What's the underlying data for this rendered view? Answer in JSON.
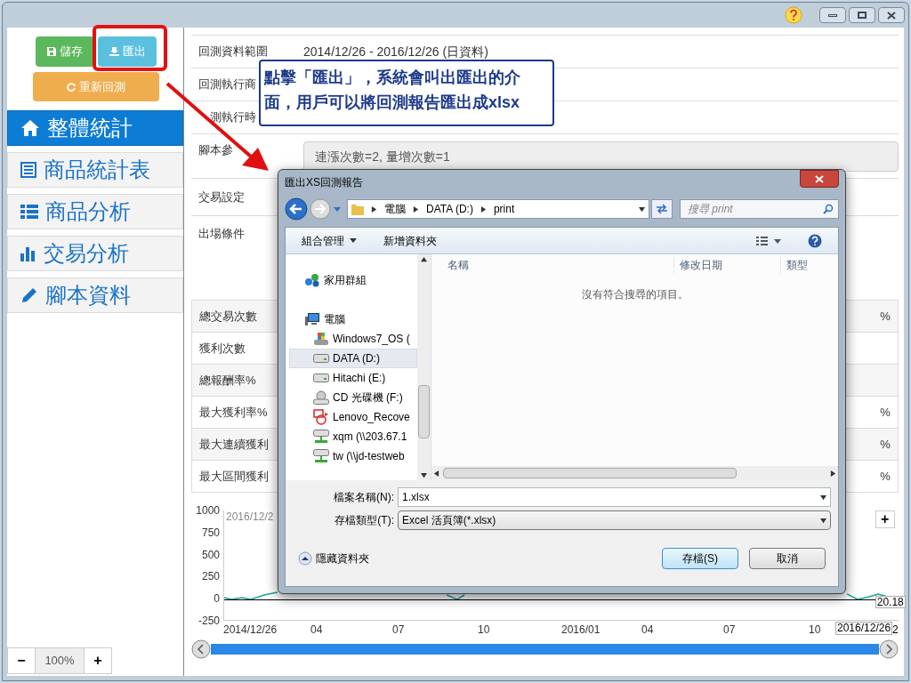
{
  "toolbar": {
    "save": "儲存",
    "export": "匯出",
    "rerun": "重新回測"
  },
  "nav": [
    {
      "label": "整體統計",
      "kind": "home",
      "selected": true
    },
    {
      "label": "商品統計表",
      "kind": "table",
      "selected": false
    },
    {
      "label": "商品分析",
      "kind": "list",
      "selected": false
    },
    {
      "label": "交易分析",
      "kind": "bars",
      "selected": false
    },
    {
      "label": "腳本資料",
      "kind": "pencil",
      "selected": false
    }
  ],
  "zoom": {
    "minus": "−",
    "value": "100%",
    "plus": "+"
  },
  "info_rows": [
    {
      "label": "回測資料範圍",
      "value": "2014/12/26 - 2016/12/26 (日資料)"
    },
    {
      "label": "回測執行商"
    },
    {
      "label": "測執行時"
    },
    {
      "label": "腳本參",
      "field": "連漲次數=2, 量增次數=1"
    },
    {
      "label": "交易設定"
    },
    {
      "label": "出場條件"
    }
  ],
  "stats_rows": [
    {
      "label": "總交易次數",
      "value": "%"
    },
    {
      "label": "獲利次數"
    },
    {
      "label": "總報酬率%"
    },
    {
      "label": "最大獲利率%",
      "value": "%"
    },
    {
      "label": "最大連續獲利",
      "value": "%"
    },
    {
      "label": "最大區間獲利",
      "value": "%"
    }
  ],
  "chart": {
    "y_labels": [
      "1000",
      "750",
      "500",
      "250",
      "0",
      "-250"
    ],
    "x_labels": [
      "2014/12/26",
      "04",
      "07",
      "10",
      "2016/01",
      "04",
      "07",
      "10"
    ],
    "start_flag": "2016/12/2",
    "end_flag": "2016/12/26",
    "last_value": "20.18",
    "cut_label": "2",
    "zoom_button": "+"
  },
  "callout": "點擊「匯出」，系統會叫出匯出的介面，用戶可以將回測報告匯出成xlsx",
  "dialog": {
    "title": "匯出XS回測報告",
    "path": [
      "電腦",
      "DATA (D:)",
      "print"
    ],
    "search": {
      "placeholder": "搜尋 print"
    },
    "organize": "組合管理",
    "new_folder": "新增資料夾",
    "tree": [
      {
        "label": "家用群組",
        "kind": "group",
        "selected": false
      },
      {
        "label": "電腦",
        "kind": "computer",
        "selected": false
      },
      {
        "label": "Windows7_OS (",
        "kind": "os",
        "selected": false
      },
      {
        "label": "DATA (D:)",
        "kind": "drive",
        "selected": true
      },
      {
        "label": "Hitachi (E:)",
        "kind": "drive",
        "selected": false
      },
      {
        "label": "CD 光碟機 (F:)",
        "kind": "cd",
        "selected": false
      },
      {
        "label": "Lenovo_Recove",
        "kind": "recovery",
        "selected": false
      },
      {
        "label": "xqm (\\\\203.67.1",
        "kind": "network",
        "selected": false
      },
      {
        "label": "tw (\\\\jd-testweb",
        "kind": "network",
        "selected": false
      }
    ],
    "columns": [
      "名稱",
      "修改日期",
      "類型"
    ],
    "empty_message": "沒有符合搜尋的項目。",
    "filename_label": "檔案名稱(N):",
    "filename": "1.xlsx",
    "filetype_label": "存檔類型(T):",
    "filetype": "Excel 活頁簿(*.xlsx)",
    "hide_folders": "隱藏資料夾",
    "save": "存檔(S)",
    "cancel": "取消"
  }
}
